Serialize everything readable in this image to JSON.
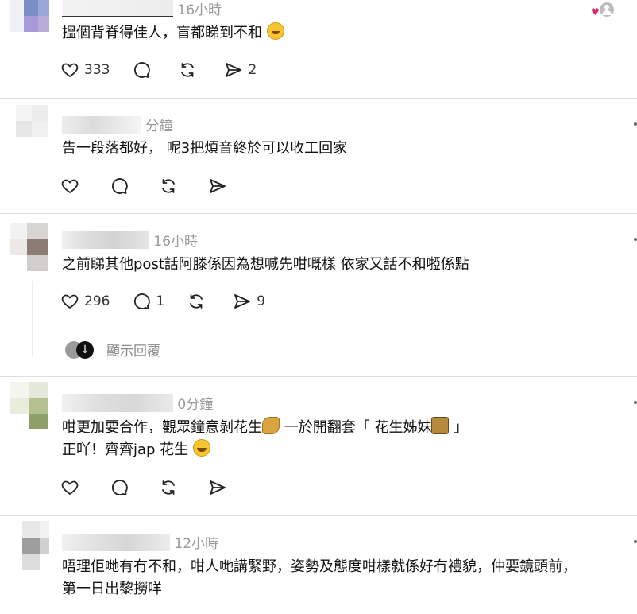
{
  "colors": {
    "like_heart": "#e0245e",
    "muted": "#999999",
    "text": "#111111"
  },
  "posts": [
    {
      "time": "16小時",
      "text": [
        "搵個背脊得佳人，盲都睇到不和"
      ],
      "emoji": [
        "rolling-laugh-emoji"
      ],
      "likes": "333",
      "comments": "",
      "reposts": "",
      "shares": "2"
    },
    {
      "time": "分鐘",
      "text": [
        "告一段落都好， 呢3把煩音終於可以收工回家"
      ],
      "likes": "",
      "comments": "",
      "reposts": "",
      "shares": ""
    },
    {
      "time": "16小時",
      "text": [
        "之前睇其他post話阿滕係因為想喊先咁嘅樣 依家又話不和𠻺係點"
      ],
      "likes": "296",
      "comments": "1",
      "reposts": "",
      "shares": "9",
      "show_replies": "顯示回覆"
    },
    {
      "time": "0分鐘",
      "text": [
        "咁更加要合作，觀眾鐘意剝花生",
        " 一於開翻套「 花生姊妹",
        " 」",
        "正吖！齊齊jap 花生"
      ],
      "emoji": [
        "peanut-emoji",
        "two-women-emoji",
        "grin-emoji"
      ],
      "likes": "",
      "comments": "",
      "reposts": "",
      "shares": ""
    },
    {
      "time": "12小時",
      "text": [
        "唔理佢哋有冇不和，咁人哋講緊野，姿勢及態度咁樣就係好冇禮貌，仲要鏡頭前，",
        "第一日出黎撈咩"
      ],
      "likes": "",
      "comments": "",
      "reposts": "",
      "shares": ""
    }
  ]
}
